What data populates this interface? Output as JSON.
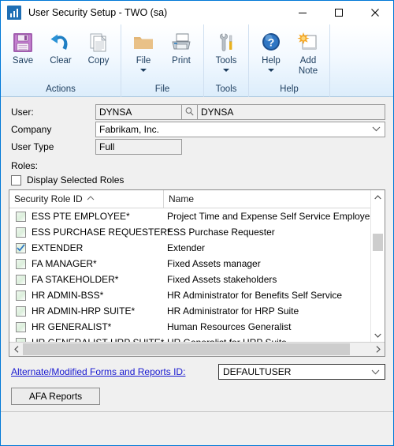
{
  "window": {
    "title": "User Security Setup  -  TWO (sa)",
    "app_icon": "chart-bars-icon",
    "minimize_label": "Minimize",
    "maximize_label": "Maximize",
    "close_label": "Close",
    "accent_color": "#0078d7"
  },
  "ribbon": {
    "groups": [
      {
        "label": "Actions",
        "buttons": [
          {
            "label": "Save",
            "icon": "floppy-disk-icon",
            "dropdown": false
          },
          {
            "label": "Clear",
            "icon": "undo-arrow-icon",
            "dropdown": false
          },
          {
            "label": "Copy",
            "icon": "copy-documents-icon",
            "dropdown": false
          }
        ]
      },
      {
        "label": "File",
        "buttons": [
          {
            "label": "File",
            "icon": "folder-icon",
            "dropdown": true
          },
          {
            "label": "Print",
            "icon": "printer-icon",
            "dropdown": false
          }
        ]
      },
      {
        "label": "Tools",
        "buttons": [
          {
            "label": "Tools",
            "icon": "wrench-screwdriver-icon",
            "dropdown": true
          }
        ]
      },
      {
        "label": "Help",
        "buttons": [
          {
            "label": "Help",
            "icon": "question-mark-icon",
            "dropdown": true
          },
          {
            "label": "Add Note",
            "icon": "note-starburst-icon",
            "dropdown": false
          }
        ]
      }
    ]
  },
  "form": {
    "user_label": "User:",
    "user_id": "DYNSA",
    "user_lookup_icon": "magnifier-lookup-icon",
    "user_name": "DYNSA",
    "company_label": "Company",
    "company_value": "Fabrikam, Inc.",
    "user_type_label": "User Type",
    "user_type_value": "Full"
  },
  "roles": {
    "section_label": "Roles:",
    "display_selected_label": "Display Selected Roles",
    "display_selected_checked": false,
    "columns": [
      "Security Role ID",
      "Name"
    ],
    "sort_column": "Security Role ID",
    "sort_direction": "ascending",
    "rows": [
      {
        "checked": false,
        "id": "ESS PTE EMPLOYEE*",
        "name": "Project Time and Expense Self Service Employee"
      },
      {
        "checked": false,
        "id": "ESS PURCHASE REQUESTER*",
        "name": "ESS Purchase Requester"
      },
      {
        "checked": true,
        "id": "EXTENDER",
        "name": "Extender"
      },
      {
        "checked": false,
        "id": "FA MANAGER*",
        "name": "Fixed Assets manager"
      },
      {
        "checked": false,
        "id": "FA STAKEHOLDER*",
        "name": "Fixed Assets stakeholders"
      },
      {
        "checked": false,
        "id": "HR ADMIN-BSS*",
        "name": "HR Administrator for Benefits Self Service"
      },
      {
        "checked": false,
        "id": "HR ADMIN-HRP SUITE*",
        "name": "HR Administrator for HRP Suite"
      },
      {
        "checked": false,
        "id": "HR GENERALIST*",
        "name": "Human Resources Generalist"
      },
      {
        "checked": false,
        "id": "HR GENERALIST-HRP SUITE*",
        "name": "HR Generalist for HRP Suite"
      }
    ]
  },
  "bottom": {
    "alternate_forms_link": "Alternate/Modified Forms and Reports ID:",
    "alternate_forms_value": "DEFAULTUSER",
    "afa_reports_label": "AFA Reports"
  }
}
